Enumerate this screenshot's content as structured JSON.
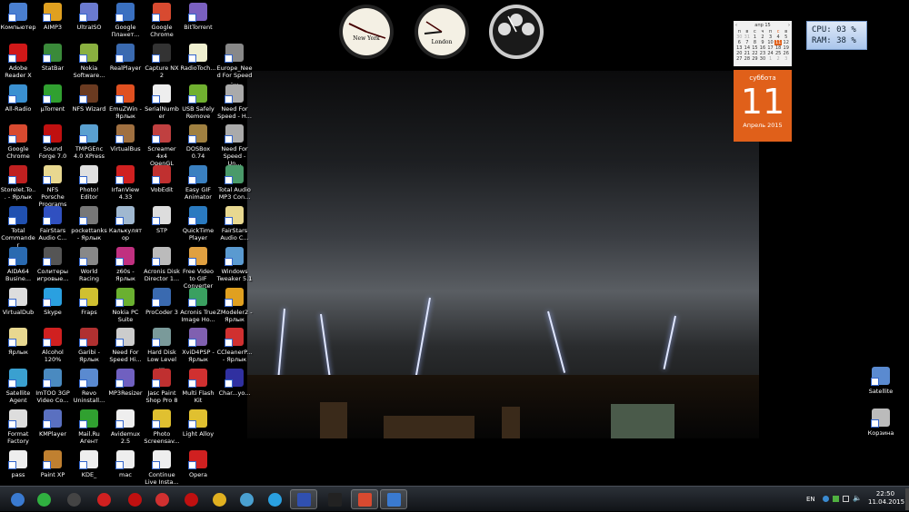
{
  "desktop_icons": [
    [
      [
        "Компьютер",
        "#4a7fd0"
      ],
      [
        "AIMP3",
        "#e0a020"
      ],
      [
        "UltraISO",
        "#6a7ad0"
      ],
      [
        "Google Планет...",
        "#3a70c0"
      ],
      [
        "Google Chrome",
        "#d84a30"
      ],
      [
        "BitTorrent",
        "#7a60c0"
      ],
      null
    ],
    [
      [
        "Adobe Reader X",
        "#d01818"
      ],
      [
        "StatBar",
        "#3a8a3a"
      ],
      [
        "Nokia Software...",
        "#8ab040"
      ],
      [
        "RealPlayer",
        "#3a6ab0"
      ],
      [
        "Capture NX 2",
        "#333333"
      ],
      [
        "RadioToch...",
        "#f0f0d0"
      ],
      [
        "Europe_Need For Speed -...",
        "#888888"
      ]
    ],
    [
      [
        "All-Radio",
        "#3a90d0"
      ],
      [
        "µTorrent",
        "#30a030"
      ],
      [
        "NFS Wizard",
        "#6a3a20"
      ],
      [
        "EmuZWin - Ярлык",
        "#e05020"
      ],
      [
        "SerialNumber",
        "#eeeeee"
      ],
      [
        "USB Safely Remove",
        "#70b030"
      ],
      [
        "Need For Speed - H...",
        "#aaaaaa"
      ]
    ],
    [
      [
        "Google Chrome",
        "#d84a30"
      ],
      [
        "Sound Forge 7.0",
        "#c01010"
      ],
      [
        "TMPGEnc 4.0 XPress",
        "#5aa0d0"
      ],
      [
        "VirtualBus",
        "#a07040"
      ],
      [
        "Screamer 4x4 OpenGL",
        "#c04040"
      ],
      [
        "DOSBox 0.74",
        "#a08040"
      ],
      [
        "Need For Speed - Un...",
        "#aaaaaa"
      ]
    ],
    [
      [
        "Storelet.To... - Ярлык",
        "#c02020"
      ],
      [
        "NFS Porsche Programs",
        "#e8d890"
      ],
      [
        "Photo! Editor",
        "#e0e0e0"
      ],
      [
        "IrfanView 4.33",
        "#d02020"
      ],
      [
        "VobEdit",
        "#c03030"
      ],
      [
        "Easy GIF Animator",
        "#3a80c0"
      ],
      [
        "Total Audio MP3 Con...",
        "#4a9a6a"
      ]
    ],
    [
      [
        "Total Commander",
        "#2050b0"
      ],
      [
        "FairStars Audio C...",
        "#3050c0"
      ],
      [
        "pockettanks - Ярлык",
        "#777777"
      ],
      [
        "Калькулятор",
        "#a0b8d0"
      ],
      [
        "STP",
        "#dddddd"
      ],
      [
        "QuickTime Player",
        "#2a7ac0"
      ],
      [
        "FairStars Audio C...",
        "#e8d890"
      ]
    ],
    [
      [
        "AIDA64 Busine...",
        "#2a6ab0"
      ],
      [
        "Солитеры игровые...",
        "#555555"
      ],
      [
        "World Racing",
        "#888888"
      ],
      [
        "z60s - Ярлык",
        "#c03080"
      ],
      [
        "Acronis Disk Director 1...",
        "#bbbbbb"
      ],
      [
        "Free Video to GIF Converter",
        "#e0a040"
      ],
      [
        "Windows Tweaker 5.1",
        "#5a9ad0"
      ]
    ],
    [
      [
        "VirtualDub",
        "#dddddd"
      ],
      [
        "Skype",
        "#2aa0e0"
      ],
      [
        "Fraps",
        "#d0c030"
      ],
      [
        "Nokia PC Suite",
        "#6ab030"
      ],
      [
        "ProCoder 3",
        "#3a6ab0"
      ],
      [
        "Acronis True Image Ho...",
        "#3aa060"
      ],
      [
        "ZModeler2 - Ярлык",
        "#e0a020"
      ]
    ],
    [
      [
        "Ярлык",
        "#e8d890"
      ],
      [
        "Alcohol 120%",
        "#d02020"
      ],
      [
        "Garibi - Ярлык",
        "#b03030"
      ],
      [
        "Need For Speed Hi...",
        "#cccccc"
      ],
      [
        "Hard Disk Low Level ...",
        "#7a9a9a"
      ],
      [
        "XviD4PSP - Ярлык",
        "#8060b0"
      ],
      [
        "CCleanerP... - Ярлык",
        "#d03030"
      ]
    ],
    [
      [
        "Satellite Agent",
        "#3aa0d0"
      ],
      [
        "ImTOO 3GP Video Co...",
        "#4a8ac0"
      ],
      [
        "Revo Uninstall...",
        "#5a8ad0"
      ],
      [
        "MP3Resizer",
        "#7060c0"
      ],
      [
        "Jasc Paint Shop Pro 8",
        "#c03030"
      ],
      [
        "Multi Flash Kit",
        "#d03030"
      ],
      [
        "Char...yo...",
        "#3030a0"
      ]
    ],
    [
      [
        "Format Factory",
        "#dddddd"
      ],
      [
        "KMPlayer",
        "#5a70c0"
      ],
      [
        "Mail.Ru Агент",
        "#30a030"
      ],
      [
        "Avidemux 2.5",
        "#eeeeee"
      ],
      [
        "Photo Screensav...",
        "#e0c030"
      ],
      [
        "Light Alloy",
        "#e0c030"
      ],
      null
    ],
    [
      [
        "pass",
        "#eeeeee"
      ],
      [
        "Paint XP",
        "#c08030"
      ],
      [
        "KDE_",
        "#eeeeee"
      ],
      [
        "mac",
        "#eeeeee"
      ],
      [
        "Continue Live Insta...",
        "#eeeeee"
      ],
      [
        "Opera",
        "#d02020"
      ],
      null
    ]
  ],
  "right_icons": [
    [
      "Satellite",
      "#5a8ad0"
    ],
    [
      "Корзина",
      "#bbbbbb"
    ]
  ],
  "clocks": [
    {
      "city": "New York"
    },
    {
      "city": "London"
    },
    {
      "city": ""
    }
  ],
  "calendar": {
    "month_nav": "апр 15",
    "prev": "‹",
    "next": "›",
    "weekdays": [
      "п",
      "в",
      "с",
      "ч",
      "п",
      "с",
      "в"
    ],
    "days": [
      "30",
      "31",
      "1",
      "2",
      "3",
      "4",
      "5",
      "6",
      "7",
      "8",
      "9",
      "10",
      "11",
      "12",
      "13",
      "14",
      "15",
      "16",
      "17",
      "18",
      "19",
      "20",
      "21",
      "22",
      "23",
      "24",
      "25",
      "26",
      "27",
      "28",
      "29",
      "30",
      "1",
      "2",
      "3"
    ],
    "selected": "11",
    "weekday_name": "суббота",
    "day": "11",
    "month_year": "Апрель 2015"
  },
  "system_meter": {
    "cpu": "CPU: 03 %",
    "ram": "RAM: 38 %"
  },
  "taskbar": {
    "items": [
      [
        "start",
        "#3a7ad0"
      ],
      [
        "mail-agent",
        "#30b040"
      ],
      [
        "capture-nx2",
        "#444444"
      ],
      [
        "garibi",
        "#d02020"
      ],
      [
        "adobe-reader",
        "#c01010"
      ],
      [
        "red-cross-app",
        "#d03030"
      ],
      [
        "opera",
        "#c01010"
      ],
      [
        "aimp",
        "#e0b020"
      ],
      [
        "ultraiso",
        "#4aa0d0"
      ],
      [
        "skype",
        "#2aa0e0"
      ],
      [
        "total-commander",
        "#3050b0"
      ],
      [
        "cmd",
        "#222222"
      ],
      [
        "chrome",
        "#d84a30"
      ],
      [
        "light-alloy",
        "#3a7ad0"
      ]
    ],
    "active": [
      10,
      12,
      13
    ],
    "lang": "EN",
    "time": "22:50",
    "date": "11.04.2015"
  }
}
